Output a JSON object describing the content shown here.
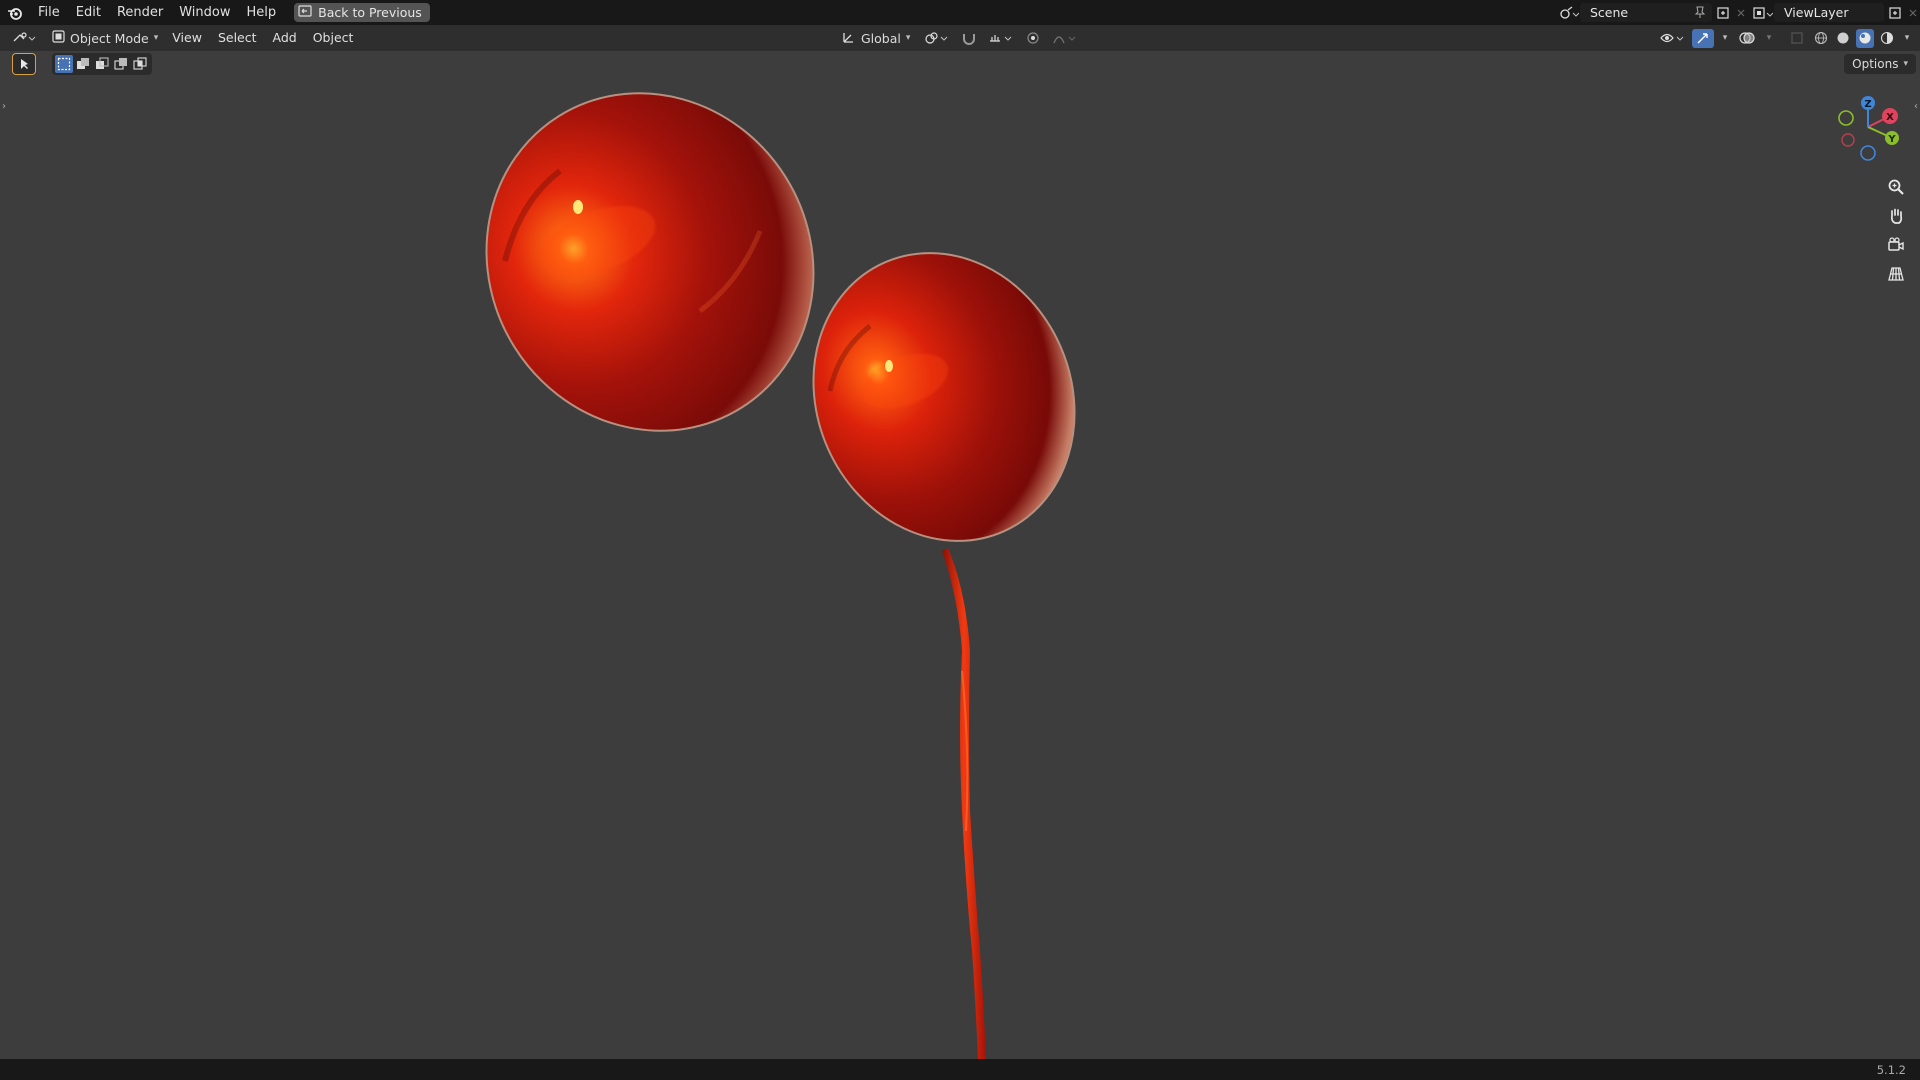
{
  "topbar": {
    "menus": [
      "File",
      "Edit",
      "Render",
      "Window",
      "Help"
    ],
    "back_label": "Back to Previous",
    "scene_name": "Scene",
    "view_layer_name": "ViewLayer"
  },
  "header": {
    "mode": "Object Mode",
    "menus": [
      "View",
      "Select",
      "Add",
      "Object"
    ],
    "transform_orientation": "Global"
  },
  "viewport": {
    "options_label": "Options",
    "gizmo_axes": {
      "x": "X",
      "y": "Y",
      "z": "Z"
    },
    "object_color": "#e0200a"
  },
  "statusbar": {
    "version": "5.1.2"
  },
  "icons": {
    "logo": "blender-logo-icon",
    "back": "back-to-previous-icon",
    "zoom": "zoom-icon",
    "pan": "pan-hand-icon",
    "camera": "camera-view-icon",
    "ortho": "perspective-grid-icon"
  }
}
